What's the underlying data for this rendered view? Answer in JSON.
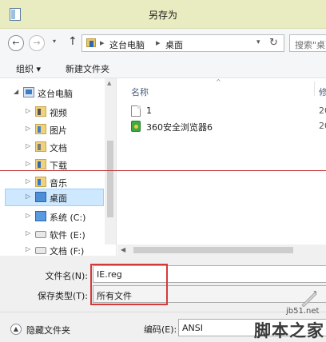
{
  "window": {
    "title": "另存为"
  },
  "nav": {
    "back_icon": "←",
    "forward_icon": "→",
    "recent_icon": "▾",
    "up_icon": "↑",
    "breadcrumb": [
      "这台电脑",
      "桌面"
    ],
    "breadcrumb_sep": "▸",
    "address_dropdown_icon": "▾",
    "refresh_icon": "↻",
    "search_placeholder": "搜索\"桌面\""
  },
  "toolbar": {
    "organize_label": "组织 ▾",
    "new_folder_label": "新建文件夹"
  },
  "sidebar": {
    "root": "这台电脑",
    "items": [
      {
        "label": "视频",
        "icon": "video-folder-icon"
      },
      {
        "label": "图片",
        "icon": "pictures-folder-icon"
      },
      {
        "label": "文档",
        "icon": "documents-folder-icon"
      },
      {
        "label": "下载",
        "icon": "downloads-folder-icon"
      },
      {
        "label": "音乐",
        "icon": "music-folder-icon"
      },
      {
        "label": "桌面",
        "icon": "desktop-folder-icon",
        "selected": true
      },
      {
        "label": "系统 (C:)",
        "icon": "system-drive-icon"
      },
      {
        "label": "软件 (E:)",
        "icon": "drive-icon"
      },
      {
        "label": "文档 (F:)",
        "icon": "drive-icon"
      }
    ]
  },
  "files": {
    "columns": {
      "name": "名称",
      "date": "修"
    },
    "rows": [
      {
        "name": "1",
        "date": "20",
        "icon": "text-file-icon"
      },
      {
        "name": "360安全浏览器6",
        "date": "20",
        "icon": "browser-shortcut-icon"
      }
    ]
  },
  "form": {
    "filename_label": "文件名(N):",
    "filename_value": "IE.reg",
    "filetype_label": "保存类型(T):",
    "filetype_value": "所有文件"
  },
  "footer": {
    "hide_folders_label": "隐藏文件夹",
    "encoding_label": "编码(E):",
    "encoding_value": "ANSI"
  },
  "watermark": {
    "url": "jb51.net",
    "name": "脚本之家"
  },
  "colors": {
    "titlebar": "#e8ecc0",
    "selected": "#cde8ff",
    "highlight_box": "#d53a3a"
  }
}
